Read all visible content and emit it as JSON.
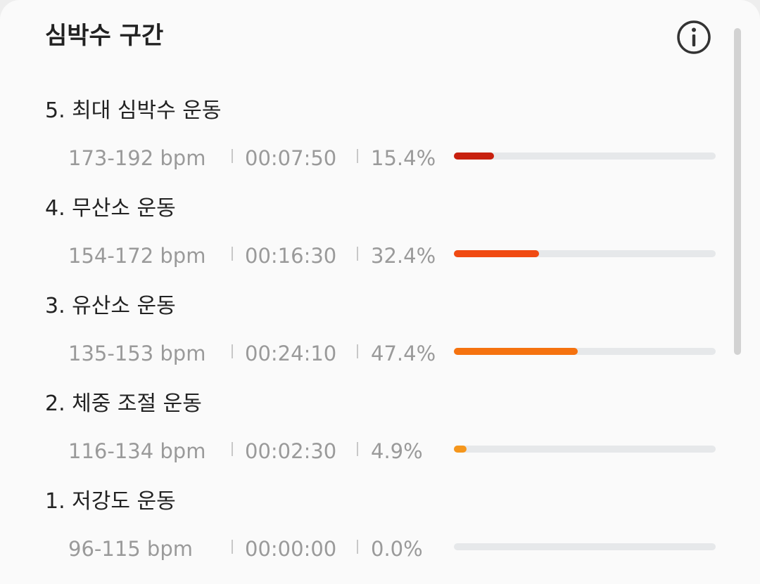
{
  "header": {
    "title": "심박수 구간",
    "info_icon": "info-circle-icon"
  },
  "zones": [
    {
      "name": "5. 최대 심박수 운동",
      "range": "173-192 bpm",
      "time": "00:07:50",
      "percent_label": "15.4%",
      "percent": 15.4,
      "color": "#c8200e"
    },
    {
      "name": "4. 무산소 운동",
      "range": "154-172 bpm",
      "time": "00:16:30",
      "percent_label": "32.4%",
      "percent": 32.4,
      "color": "#f04a12"
    },
    {
      "name": "3. 유산소 운동",
      "range": "135-153 bpm",
      "time": "00:24:10",
      "percent_label": "47.4%",
      "percent": 47.4,
      "color": "#f5720f"
    },
    {
      "name": "2. 체중 조절 운동",
      "range": "116-134 bpm",
      "time": "00:02:30",
      "percent_label": "4.9%",
      "percent": 4.9,
      "color": "#f5961c"
    },
    {
      "name": "1. 저강도 운동",
      "range": "96-115 bpm",
      "time": "00:00:00",
      "percent_label": "0.0%",
      "percent": 0.0,
      "color": "#f5b02a"
    }
  ],
  "colors": {
    "track": "#e6e8ea",
    "title_text": "#222222",
    "secondary_text": "#9a9a9a"
  }
}
